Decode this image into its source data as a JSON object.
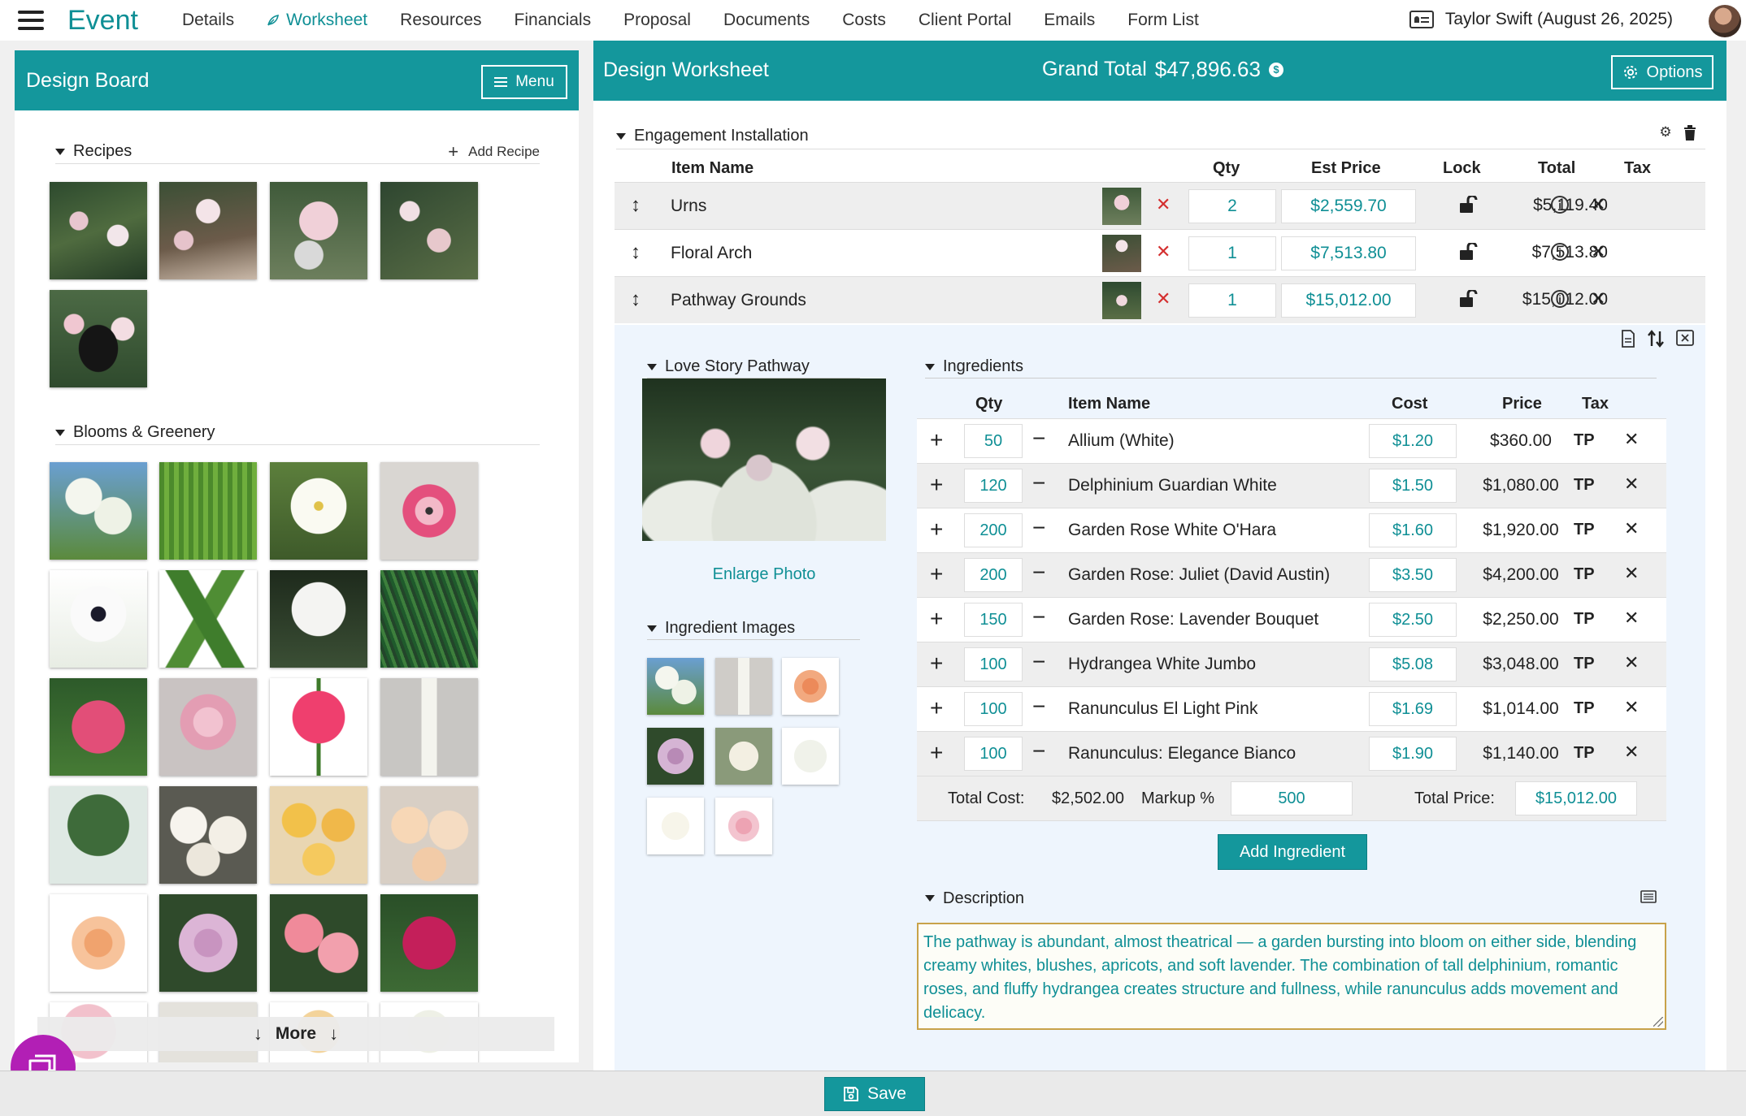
{
  "nav": {
    "brand": "Event",
    "links": [
      {
        "label": "Details",
        "active": false
      },
      {
        "label": "Worksheet",
        "active": true
      },
      {
        "label": "Resources",
        "active": false
      },
      {
        "label": "Financials",
        "active": false
      },
      {
        "label": "Proposal",
        "active": false
      },
      {
        "label": "Documents",
        "active": false
      },
      {
        "label": "Costs",
        "active": false
      },
      {
        "label": "Client Portal",
        "active": false
      },
      {
        "label": "Emails",
        "active": false
      },
      {
        "label": "Form List",
        "active": false
      }
    ],
    "user_label": "Taylor Swift (August 26, 2025)"
  },
  "design_board": {
    "title": "Design Board",
    "menu_label": "Menu",
    "recipes_label": "Recipes",
    "add_recipe_label": "Add Recipe",
    "blooms_label": "Blooms & Greenery",
    "more_label": "More"
  },
  "worksheet": {
    "title": "Design Worksheet",
    "grand_total_label": "Grand Total",
    "grand_total_value": "$47,896.63",
    "options_label": "Options",
    "section_title": "Engagement Installation",
    "columns": [
      "Item Name",
      "Qty",
      "Est Price",
      "Lock",
      "Total",
      "Tax"
    ],
    "items": [
      {
        "name": "Urns",
        "qty": "2",
        "est_price": "$2,559.70",
        "total": "$5,119.40"
      },
      {
        "name": "Floral Arch",
        "qty": "1",
        "est_price": "$7,513.80",
        "total": "$7,513.80"
      },
      {
        "name": "Pathway Grounds",
        "qty": "1",
        "est_price": "$15,012.00",
        "total": "$15,012.00"
      }
    ]
  },
  "recipe": {
    "name": "Love Story Pathway",
    "enlarge_label": "Enlarge Photo",
    "ingredient_images_label": "Ingredient Images",
    "ingredients_label": "Ingredients",
    "columns": [
      "Qty",
      "Item Name",
      "Cost",
      "Price",
      "Tax"
    ],
    "ingredients": [
      {
        "qty": "50",
        "name": "Allium (White)",
        "cost": "$1.20",
        "price": "$360.00",
        "tax": "TP"
      },
      {
        "qty": "120",
        "name": "Delphinium Guardian White",
        "cost": "$1.50",
        "price": "$1,080.00",
        "tax": "TP"
      },
      {
        "qty": "200",
        "name": "Garden Rose White O'Hara",
        "cost": "$1.60",
        "price": "$1,920.00",
        "tax": "TP"
      },
      {
        "qty": "200",
        "name": "Garden Rose: Juliet (David Austin)",
        "cost": "$3.50",
        "price": "$4,200.00",
        "tax": "TP"
      },
      {
        "qty": "150",
        "name": "Garden Rose: Lavender Bouquet",
        "cost": "$2.50",
        "price": "$2,250.00",
        "tax": "TP"
      },
      {
        "qty": "100",
        "name": "Hydrangea White Jumbo",
        "cost": "$5.08",
        "price": "$3,048.00",
        "tax": "TP"
      },
      {
        "qty": "100",
        "name": "Ranunculus El Light Pink",
        "cost": "$1.69",
        "price": "$1,014.00",
        "tax": "TP"
      },
      {
        "qty": "100",
        "name": "Ranunculus: Elegance Bianco",
        "cost": "$1.90",
        "price": "$1,140.00",
        "tax": "TP"
      }
    ],
    "total_cost_label": "Total Cost:",
    "total_cost_value": "$2,502.00",
    "markup_label": "Markup %",
    "markup_value": "500",
    "total_price_label": "Total Price:",
    "total_price_value": "$15,012.00",
    "add_ingredient_label": "Add Ingredient",
    "description_label": "Description",
    "description_text": "The pathway is abundant, almost theatrical — a garden bursting into bloom on either side, blending creamy whites, blushes, apricots, and soft lavender. The combination of tall delphinium, romantic roses, and fluffy hydrangea creates structure and fullness, while ranunculus adds movement and delicacy."
  },
  "footer": {
    "save_label": "Save"
  },
  "colors": {
    "accent": "#14979c",
    "accent_text": "#0f8f95",
    "remove_red": "#d42f2f",
    "chat": "#b21fb5"
  }
}
